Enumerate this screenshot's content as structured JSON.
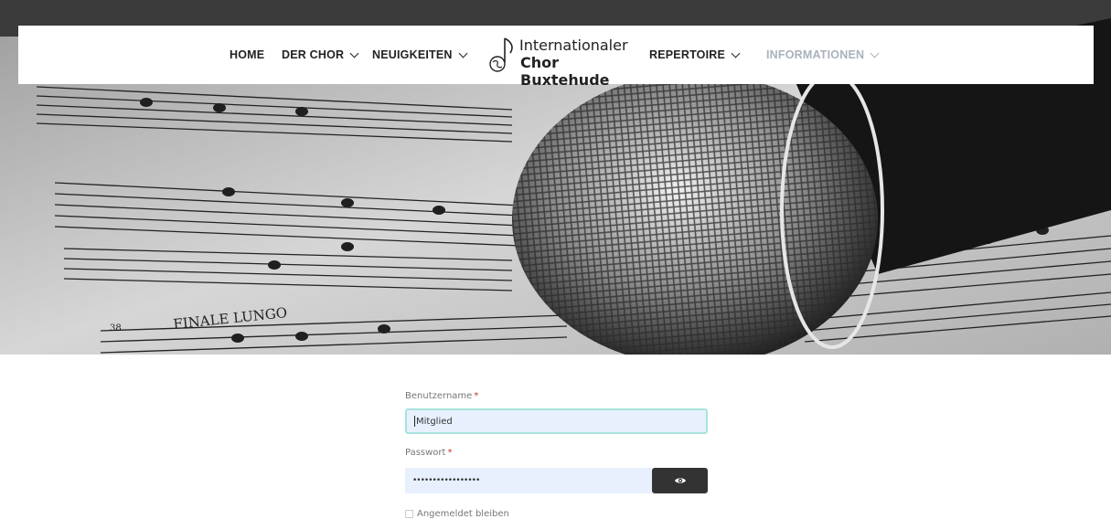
{
  "nav": {
    "items_left": [
      {
        "label": "HOME",
        "has_dropdown": false
      },
      {
        "label": "DER CHOR",
        "has_dropdown": true
      },
      {
        "label": "NEUIGKEITEN",
        "has_dropdown": true
      }
    ],
    "items_right": [
      {
        "label": "REPERTOIRE",
        "has_dropdown": true
      },
      {
        "label": "INFORMATIONEN",
        "has_dropdown": true
      }
    ],
    "logo": {
      "line1": "Internationaler",
      "line2": "Chor Buxtehude",
      "icon": "music-note-globe-icon"
    }
  },
  "hero": {
    "score_text": "FINALE LUNGO",
    "measure_number": "38"
  },
  "form": {
    "username_label": "Benutzername",
    "username_value": "Mitglied",
    "password_label": "Passwort",
    "password_value": "•••••••••••••••••",
    "required_mark": "*",
    "toggle_icon": "eye-icon",
    "remember_label": "Angemeldet bleiben"
  },
  "colors": {
    "nav_active": "#222222",
    "nav_muted": "#a9b2bc",
    "input_bg": "#e8f0fe",
    "focus_border": "#a7e3dd",
    "button_bg": "#333333"
  }
}
